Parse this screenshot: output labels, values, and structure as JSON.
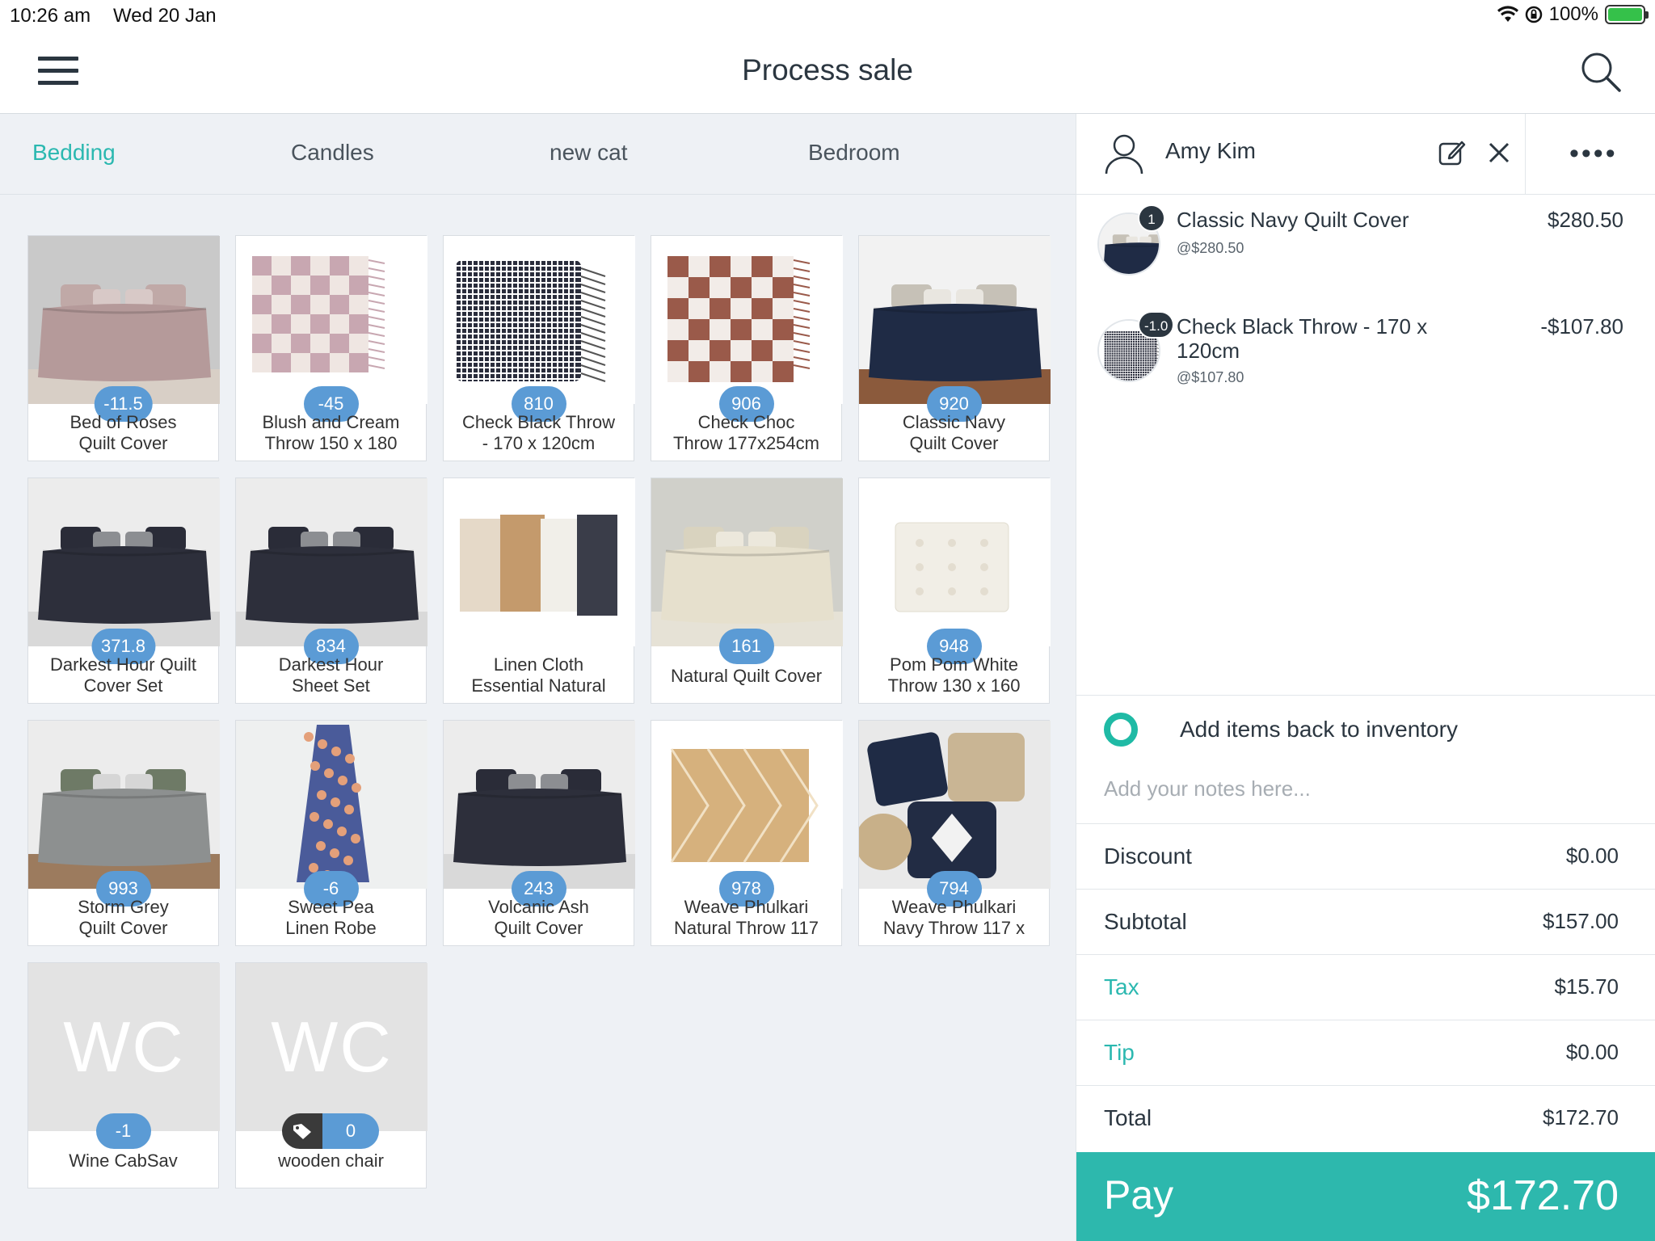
{
  "status_bar": {
    "time": "10:26 am",
    "date": "Wed 20 Jan",
    "battery": "100%"
  },
  "header": {
    "title": "Process sale",
    "menu_icon": "hamburger-menu-icon",
    "search_icon": "search-icon"
  },
  "categories": [
    {
      "label": "Bedding",
      "active": true
    },
    {
      "label": "Candles",
      "active": false
    },
    {
      "label": "new cat",
      "active": false
    },
    {
      "label": "Bedroom",
      "active": false
    }
  ],
  "products": [
    {
      "name": "Bed of Roses\nQuilt Cover",
      "stock": "-11.5",
      "image": "pink-bed"
    },
    {
      "name": "Blush and Cream\nThrow 150 x 180",
      "stock": "-45",
      "image": "pink-throw"
    },
    {
      "name": "Check Black Throw\n- 170 x 120cm",
      "stock": "810",
      "image": "black-check-throw"
    },
    {
      "name": "Check Choc\nThrow 177x254cm",
      "stock": "906",
      "image": "choc-check-throw"
    },
    {
      "name": "Classic Navy\nQuilt Cover",
      "stock": "920",
      "image": "navy-bed"
    },
    {
      "name": "Darkest Hour Quilt\nCover Set",
      "stock": "371.8",
      "image": "dark-bed"
    },
    {
      "name": "Darkest Hour\nSheet Set",
      "stock": "834",
      "image": "dark-bed"
    },
    {
      "name": "Linen Cloth\nEssential Natural",
      "stock": "",
      "image": "folded-linen"
    },
    {
      "name": "Natural Quilt Cover",
      "stock": "161",
      "image": "natural-bed"
    },
    {
      "name": "Pom Pom White\nThrow 130 x 160",
      "stock": "948",
      "image": "white-throw"
    },
    {
      "name": "Storm Grey\nQuilt Cover",
      "stock": "993",
      "image": "grey-bed"
    },
    {
      "name": "Sweet Pea\nLinen Robe",
      "stock": "-6",
      "image": "floral-robe"
    },
    {
      "name": "Volcanic Ash\nQuilt Cover",
      "stock": "243",
      "image": "dark-bed"
    },
    {
      "name": "Weave Phulkari\nNatural Throw 117",
      "stock": "978",
      "image": "natural-rug"
    },
    {
      "name": "Weave Phulkari\nNavy Throw 117 x",
      "stock": "794",
      "image": "navy-cushions"
    },
    {
      "name": "Wine CabSav",
      "stock": "-1",
      "image": "placeholder",
      "initials": "WC"
    },
    {
      "name": "wooden chair",
      "stock": "0",
      "image": "placeholder",
      "initials": "WC",
      "tag": true
    }
  ],
  "customer": {
    "name": "Amy Kim",
    "edit_icon": "edit-icon",
    "close_icon": "close-icon",
    "more_label": "••••"
  },
  "cart": [
    {
      "name": "Classic Navy Quilt Cover",
      "qty": "1",
      "unit": "@$280.50",
      "price": "$280.50",
      "image": "navy-bed"
    },
    {
      "name": "Check Black Throw - 170 x 120cm",
      "qty": "-1.0",
      "unit": "@$107.80",
      "price": "-$107.80",
      "image": "black-check-throw"
    }
  ],
  "inventory": {
    "label": "Add items back to inventory",
    "notes_placeholder": "Add your notes here..."
  },
  "summary": {
    "discount_label": "Discount",
    "discount": "$0.00",
    "subtotal_label": "Subtotal",
    "subtotal": "$157.00",
    "tax_label": "Tax",
    "tax": "$15.70",
    "tip_label": "Tip",
    "tip": "$0.00",
    "total_label": "Total",
    "total": "$172.70"
  },
  "pay": {
    "label": "Pay",
    "amount": "$172.70"
  },
  "colors": {
    "accent": "#2bb8b0",
    "pay_bg": "#2db8ad",
    "badge": "#5b9bd5",
    "text": "#2b3640",
    "panel_bg": "#eef1f5"
  }
}
